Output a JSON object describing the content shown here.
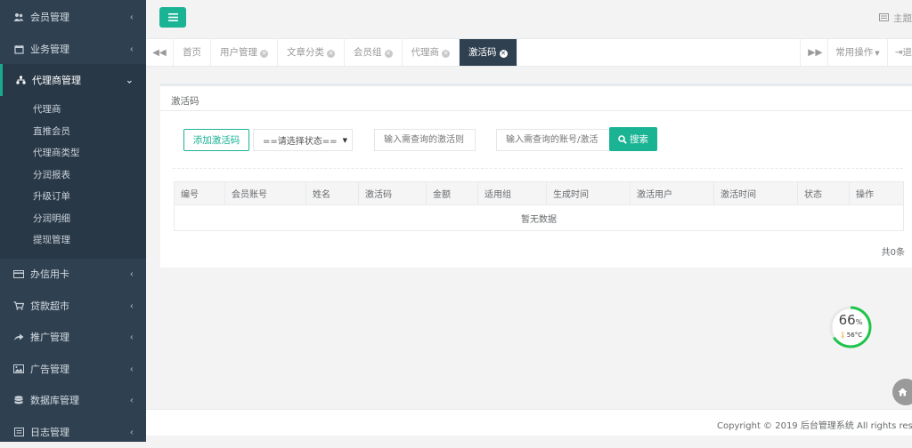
{
  "sidebar": {
    "items": [
      {
        "label": "会员管理",
        "icon": "users-icon"
      },
      {
        "label": "业务管理",
        "icon": "calendar-icon"
      },
      {
        "label": "代理商管理",
        "icon": "sitemap-icon",
        "active": true,
        "children": [
          "代理商",
          "直推会员",
          "代理商类型",
          "分润报表",
          "升级订单",
          "分润明细",
          "提现管理"
        ]
      },
      {
        "label": "办信用卡",
        "icon": "credit-card-icon"
      },
      {
        "label": "贷款超市",
        "icon": "cart-icon"
      },
      {
        "label": "推广管理",
        "icon": "share-icon"
      },
      {
        "label": "广告管理",
        "icon": "image-icon"
      },
      {
        "label": "数据库管理",
        "icon": "database-icon"
      },
      {
        "label": "日志管理",
        "icon": "log-icon"
      }
    ]
  },
  "topbar": {
    "right_label": "主题"
  },
  "tabbar": {
    "tabs": [
      {
        "label": "首页",
        "closable": false
      },
      {
        "label": "用户管理",
        "closable": true
      },
      {
        "label": "文章分类",
        "closable": true
      },
      {
        "label": "会员组",
        "closable": true
      },
      {
        "label": "代理商",
        "closable": true
      },
      {
        "label": "激活码",
        "closable": true,
        "active": true
      }
    ],
    "common_ops": "常用操作",
    "exit_label": "退"
  },
  "panel": {
    "title": "激活码",
    "add_button": "添加激活码",
    "status_select": "==请选择状态==",
    "search_input1_placeholder": "输入需查询的激活则",
    "search_input2_placeholder": "输入需查询的账号/激活",
    "search_button": "搜索",
    "table": {
      "headers": [
        "编号",
        "会员账号",
        "姓名",
        "激活码",
        "金额",
        "适用组",
        "生成时间",
        "激活用户",
        "激活时间",
        "状态",
        "操作"
      ],
      "empty_text": "暂无数据"
    },
    "total_text": "共0条"
  },
  "footer": {
    "copyright": "Copyright © 2019 后台管理系统 All rights reserved"
  },
  "gauge": {
    "percent": "66",
    "percent_sign": "%",
    "temp": "56°C",
    "color": "#1fc54b"
  },
  "colors": {
    "accent": "#1ab394",
    "sidebar": "#2f4050"
  }
}
